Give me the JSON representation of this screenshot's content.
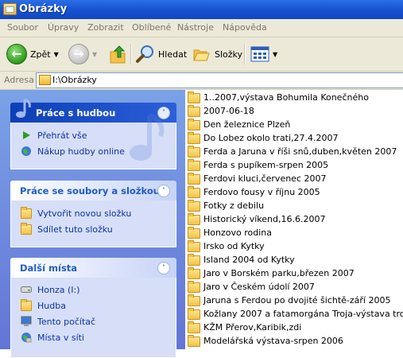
{
  "window": {
    "title": "Obrázky"
  },
  "menu": [
    "Soubor",
    "Úpravy",
    "Zobrazit",
    "Oblíbené",
    "Nástroje",
    "Nápověda"
  ],
  "toolbar": {
    "back_label": "Zpět",
    "search_label": "Hledat",
    "folders_label": "Složky"
  },
  "address": {
    "label": "Adresa",
    "value": "I:\\Obrázky"
  },
  "panels": {
    "music": {
      "title": "Práce s hudbou",
      "items": [
        "Přehrát vše",
        "Nákup hudby online"
      ]
    },
    "files": {
      "title": "Práce se soubory a složkou",
      "items": [
        "Vytvořit novou složku",
        "Sdílet tuto složku"
      ]
    },
    "places": {
      "title": "Další místa",
      "items": [
        "Honza (I:)",
        "Hudba",
        "Tento počítač",
        "Místa v síti"
      ]
    }
  },
  "folders": [
    "1..2007,výstava Bohumila Konečného",
    "2007-06-18",
    "Den železnice Plzeň",
    "Do Lobez okolo trati,27.4.2007",
    "Ferda a Jaruna v říši snů,duben,květen 2007",
    "Ferda s pupíkem-srpen 2005",
    "Ferdovi kluci,červenec 2007",
    "Ferdovo fousy v říjnu 2005",
    "Fotky z debilu",
    "Historický víkend,16.6.2007",
    "Honzovo rodina",
    "Irsko od Kytky",
    "Island 2004 od Kytky",
    "Jaro v Borském parku,březen 2007",
    "Jaro v Českém údolí 2007",
    "Jaruna s Ferdou po dvojité šichtě-září 2005",
    "Kožlany 2007 a fatamorgána Troja-výstava trop. motýlů",
    "KŽM Přerov,Karibik,zdi",
    "Modelářská výstava-srpen 2006"
  ]
}
